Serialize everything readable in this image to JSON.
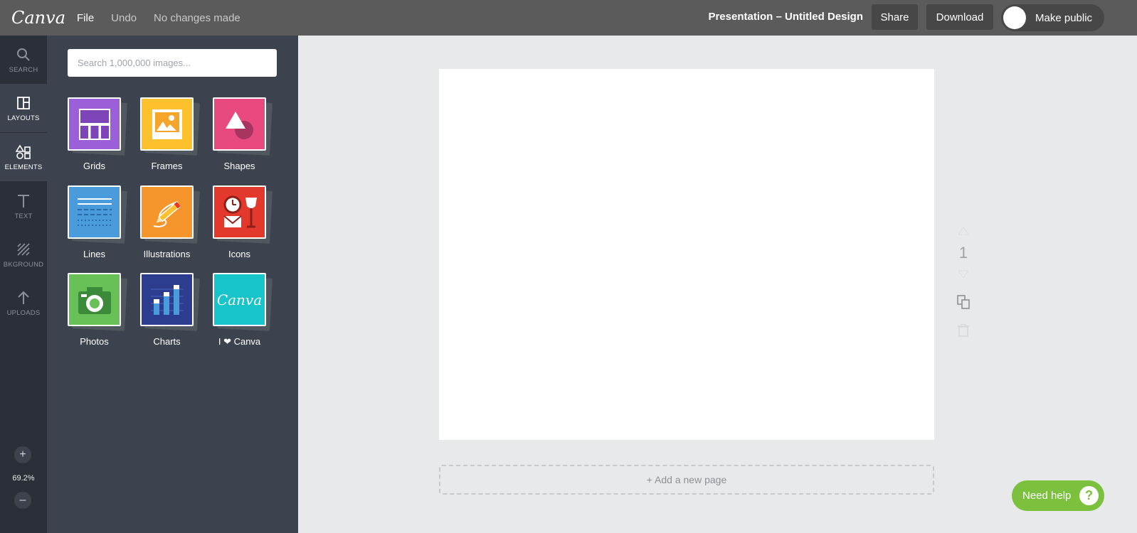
{
  "topbar": {
    "logo": "Canva",
    "menu": [
      "File",
      "Undo",
      "No changes made"
    ],
    "document_title": "Presentation – Untitled Design",
    "share_label": "Share",
    "download_label": "Download",
    "public_label": "Make public"
  },
  "rail": {
    "items": [
      {
        "label": "SEARCH",
        "icon": "search-icon"
      },
      {
        "label": "LAYOUTS",
        "icon": "layouts-icon"
      },
      {
        "label": "ELEMENTS",
        "icon": "elements-icon",
        "active": true
      },
      {
        "label": "TEXT",
        "icon": "text-icon"
      },
      {
        "label": "BKGROUND",
        "icon": "background-icon"
      },
      {
        "label": "UPLOADS",
        "icon": "upload-icon"
      }
    ],
    "zoom_in": "+",
    "zoom_level": "69.2%",
    "zoom_out": "–"
  },
  "panel": {
    "search_placeholder": "Search 1,000,000 images...",
    "tiles": [
      {
        "label": "Grids",
        "color": "#9b5fd8"
      },
      {
        "label": "Frames",
        "color": "#fcc12c"
      },
      {
        "label": "Shapes",
        "color": "#e8497f"
      },
      {
        "label": "Lines",
        "color": "#4a9bdc"
      },
      {
        "label": "Illustrations",
        "color": "#f5952b"
      },
      {
        "label": "Icons",
        "color": "#e2392c"
      },
      {
        "label": "Photos",
        "color": "#68c157"
      },
      {
        "label": "Charts",
        "color": "#2c3d8f"
      },
      {
        "label": "I ❤ Canva",
        "color": "#17c4c9"
      }
    ]
  },
  "canvas": {
    "page_number": "1",
    "add_page_label": "+ Add a new page"
  },
  "help": {
    "label": "Need help",
    "icon_glyph": "?"
  }
}
